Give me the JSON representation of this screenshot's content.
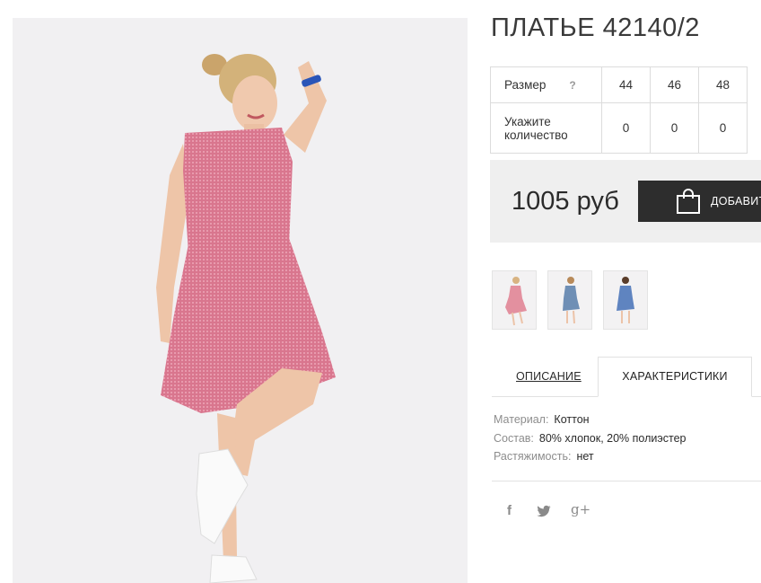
{
  "product": {
    "title": "ПЛАТЬЕ 42140/2",
    "price": "1005 руб",
    "add_to_cart_label": "ДОБАВИТ"
  },
  "size_table": {
    "size_label": "Размер",
    "help_icon": "?",
    "sizes": [
      "44",
      "46",
      "48"
    ],
    "qty_label_line1": "Укажите",
    "qty_label_line2": "количество",
    "quantities": [
      "0",
      "0",
      "0"
    ]
  },
  "thumbnails": [
    {
      "icon": "pink-dress-thumbnail"
    },
    {
      "icon": "blue-dress-thumbnail"
    },
    {
      "icon": "blue-dress-thumbnail-2"
    }
  ],
  "tabs": {
    "description": "ОПИСАНИЕ",
    "characteristics": "ХАРАКТЕРИСТИКИ"
  },
  "specs": {
    "material_key": "Материал:",
    "material_val": "Коттон",
    "composition_key": "Состав:",
    "composition_val": "80% хлопок, 20% полиэстер",
    "stretch_key": "Растяжимость:",
    "stretch_val": "нет"
  },
  "social": {
    "facebook": "f",
    "twitter": "twitter-icon",
    "google": "g+"
  },
  "colors": {
    "dress_pink": "#d97a92",
    "dark_button": "#2d2d2d",
    "price_bg": "#efefef"
  }
}
